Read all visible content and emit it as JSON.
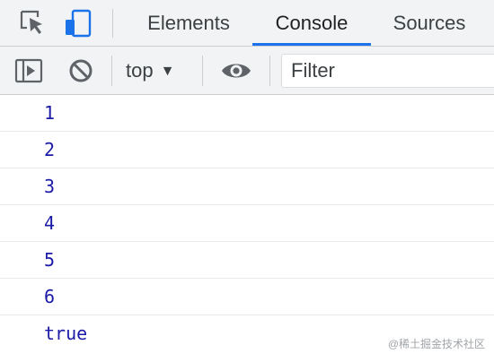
{
  "tabs": [
    {
      "label": "Elements",
      "active": false
    },
    {
      "label": "Console",
      "active": true
    },
    {
      "label": "Sources",
      "active": false
    }
  ],
  "icons": {
    "inspect": "inspect-element-icon",
    "device": "device-toolbar-icon",
    "sidebar": "sidebar-toggle-icon",
    "clear": "clear-console-icon",
    "eye": "live-expression-eye-icon",
    "context_caret": "caret-down-icon"
  },
  "toolbar": {
    "context": "top",
    "context_caret": "▼",
    "filter_placeholder": "Filter"
  },
  "console_lines": [
    "1",
    "2",
    "3",
    "4",
    "5",
    "6",
    "true"
  ],
  "watermark": "@稀土掘金技术社区",
  "colors": {
    "accent": "#1a73e8",
    "value_text": "#1a1aa6",
    "toolbar_bg": "#f1f3f4"
  }
}
